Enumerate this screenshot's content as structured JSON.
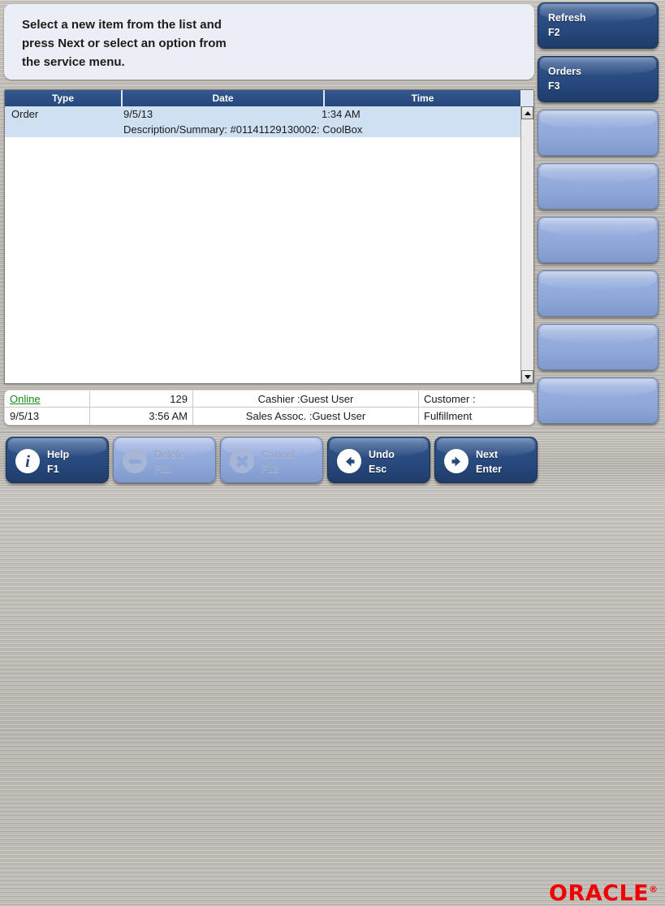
{
  "message": {
    "text": "Select a new item from the list and\npress Next or select an option from\nthe service menu."
  },
  "list": {
    "columns": [
      "Type",
      "Date",
      "Time"
    ],
    "rows": [
      {
        "type": "Order",
        "date": "9/5/13",
        "time": "1:34 AM",
        "description": "Description/Summary: #01141129130002: CoolBox"
      }
    ],
    "scrollbar": {
      "up_icon": "scroll-up-arrow-icon",
      "down_icon": "scroll-down-arrow-icon"
    }
  },
  "status": {
    "connection": "Online",
    "register": "129",
    "cashier": "Cashier :Guest User",
    "customer": "Customer :",
    "date": "9/5/13",
    "time": "3:56 AM",
    "sales_assoc": "Sales Assoc. :Guest User",
    "mode": "Fulfillment"
  },
  "sidebar": {
    "buttons": [
      {
        "label": "Refresh\nF2",
        "enabled": true
      },
      {
        "label": "Orders\nF3",
        "enabled": true
      },
      {
        "label": "",
        "enabled": false
      },
      {
        "label": "",
        "enabled": false
      },
      {
        "label": "",
        "enabled": false
      },
      {
        "label": "",
        "enabled": false
      },
      {
        "label": "",
        "enabled": false
      },
      {
        "label": "",
        "enabled": false
      }
    ]
  },
  "actions": {
    "buttons": [
      {
        "label": "Help\nF1",
        "icon": "info-icon",
        "enabled": true
      },
      {
        "label": "Delete\nF11",
        "icon": "minus-icon",
        "enabled": false
      },
      {
        "label": "Cancel\nF12",
        "icon": "close-icon",
        "enabled": false
      },
      {
        "label": "Undo\nEsc",
        "icon": "arrow-left-icon",
        "enabled": true
      },
      {
        "label": "Next\nEnter",
        "icon": "arrow-right-icon",
        "enabled": true
      }
    ]
  },
  "branding": {
    "logo_text": "ORACLE",
    "logo_mark": "®",
    "logo_color": "#f00000"
  },
  "theme": {
    "accent": "#27487c",
    "header_blue": "#2c4f85",
    "row_select": "#cfe0f2",
    "link_green": "#138a16"
  }
}
